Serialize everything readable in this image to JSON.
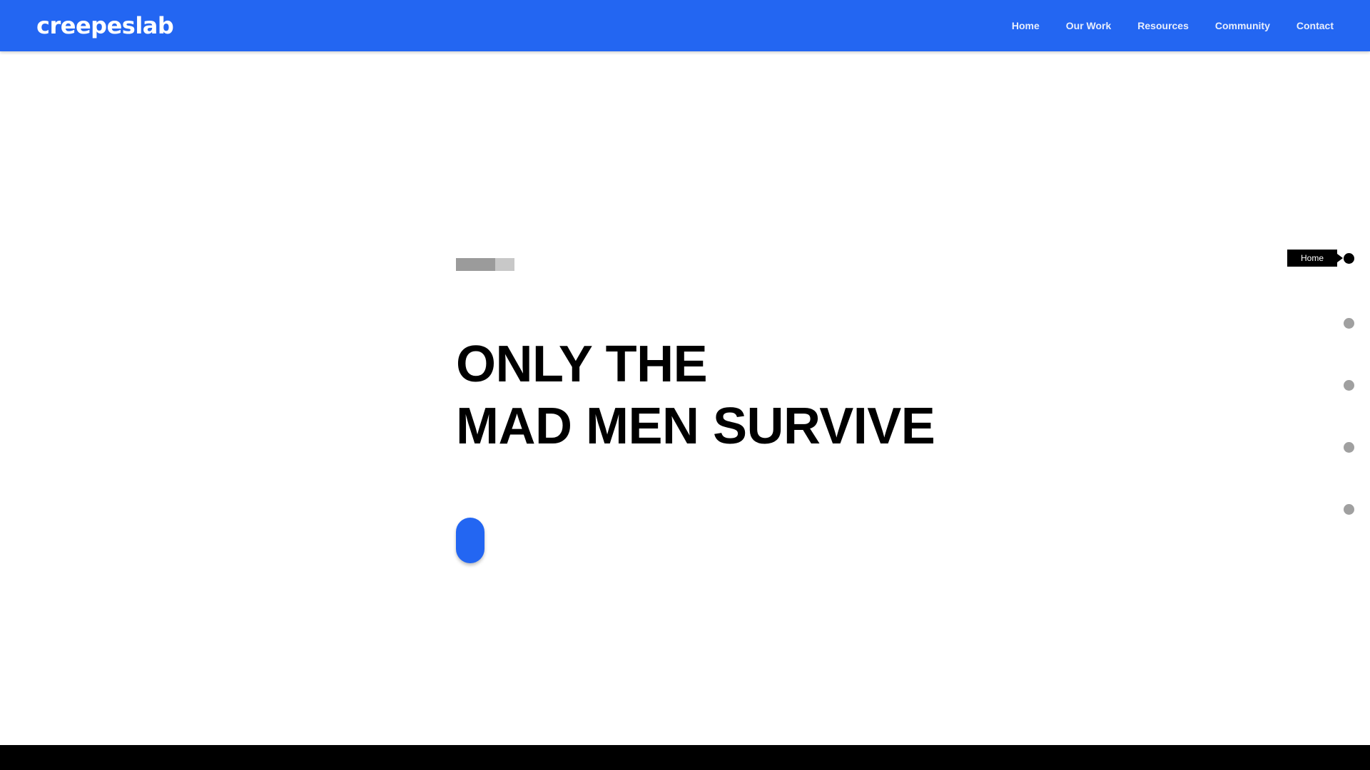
{
  "brand": {
    "name": "creepeslab",
    "color": "#2366f2"
  },
  "nav": {
    "items": [
      {
        "label": "Home"
      },
      {
        "label": "Our Work"
      },
      {
        "label": "Resources"
      },
      {
        "label": "Community"
      },
      {
        "label": "Contact"
      }
    ]
  },
  "hero": {
    "progress": 0.67,
    "headline_line1": "ONLY THE",
    "headline_line2": "MAD MEN SURVIVE"
  },
  "section_nav": {
    "active_label": "Home",
    "count": 5,
    "active_index": 0
  }
}
